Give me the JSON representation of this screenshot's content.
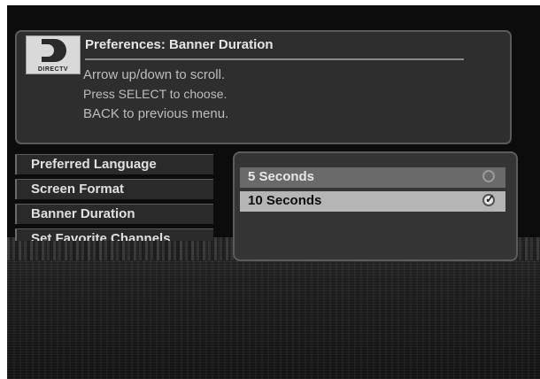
{
  "header": {
    "logo_text": "DIRECTV",
    "title": "Preferences: Banner Duration",
    "instructions": [
      "Arrow up/down to scroll.",
      "Press SELECT to choose.",
      "BACK to previous menu."
    ]
  },
  "menu": {
    "items": [
      {
        "label": "Preferred Language"
      },
      {
        "label": "Screen Format"
      },
      {
        "label": "Banner Duration"
      },
      {
        "label": "Set Favorite Channels"
      }
    ]
  },
  "options": {
    "items": [
      {
        "label": "5  Seconds",
        "selected": false
      },
      {
        "label": "10 Seconds",
        "selected": true
      }
    ]
  },
  "icons": {
    "radio_empty": "radio-empty-icon",
    "radio_checked": "radio-checked-icon",
    "logo": "directv-logo"
  },
  "colors": {
    "screen_bg": "#0c0c0c",
    "panel_bg": "#2e2e2e",
    "selected_option_bg": "#b5b5b5"
  }
}
